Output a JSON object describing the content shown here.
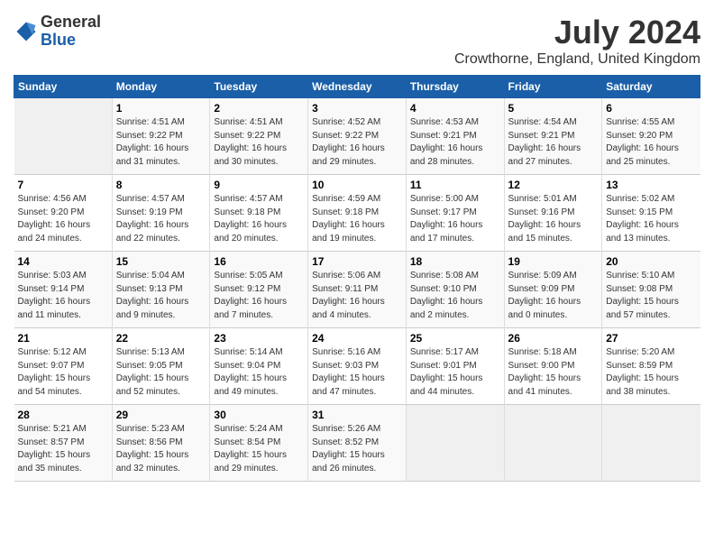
{
  "logo": {
    "general": "General",
    "blue": "Blue"
  },
  "header": {
    "month_year": "July 2024",
    "location": "Crowthorne, England, United Kingdom"
  },
  "weekdays": [
    "Sunday",
    "Monday",
    "Tuesday",
    "Wednesday",
    "Thursday",
    "Friday",
    "Saturday"
  ],
  "weeks": [
    [
      {
        "day": "",
        "detail": ""
      },
      {
        "day": "1",
        "detail": "Sunrise: 4:51 AM\nSunset: 9:22 PM\nDaylight: 16 hours\nand 31 minutes."
      },
      {
        "day": "2",
        "detail": "Sunrise: 4:51 AM\nSunset: 9:22 PM\nDaylight: 16 hours\nand 30 minutes."
      },
      {
        "day": "3",
        "detail": "Sunrise: 4:52 AM\nSunset: 9:22 PM\nDaylight: 16 hours\nand 29 minutes."
      },
      {
        "day": "4",
        "detail": "Sunrise: 4:53 AM\nSunset: 9:21 PM\nDaylight: 16 hours\nand 28 minutes."
      },
      {
        "day": "5",
        "detail": "Sunrise: 4:54 AM\nSunset: 9:21 PM\nDaylight: 16 hours\nand 27 minutes."
      },
      {
        "day": "6",
        "detail": "Sunrise: 4:55 AM\nSunset: 9:20 PM\nDaylight: 16 hours\nand 25 minutes."
      }
    ],
    [
      {
        "day": "7",
        "detail": "Sunrise: 4:56 AM\nSunset: 9:20 PM\nDaylight: 16 hours\nand 24 minutes."
      },
      {
        "day": "8",
        "detail": "Sunrise: 4:57 AM\nSunset: 9:19 PM\nDaylight: 16 hours\nand 22 minutes."
      },
      {
        "day": "9",
        "detail": "Sunrise: 4:57 AM\nSunset: 9:18 PM\nDaylight: 16 hours\nand 20 minutes."
      },
      {
        "day": "10",
        "detail": "Sunrise: 4:59 AM\nSunset: 9:18 PM\nDaylight: 16 hours\nand 19 minutes."
      },
      {
        "day": "11",
        "detail": "Sunrise: 5:00 AM\nSunset: 9:17 PM\nDaylight: 16 hours\nand 17 minutes."
      },
      {
        "day": "12",
        "detail": "Sunrise: 5:01 AM\nSunset: 9:16 PM\nDaylight: 16 hours\nand 15 minutes."
      },
      {
        "day": "13",
        "detail": "Sunrise: 5:02 AM\nSunset: 9:15 PM\nDaylight: 16 hours\nand 13 minutes."
      }
    ],
    [
      {
        "day": "14",
        "detail": "Sunrise: 5:03 AM\nSunset: 9:14 PM\nDaylight: 16 hours\nand 11 minutes."
      },
      {
        "day": "15",
        "detail": "Sunrise: 5:04 AM\nSunset: 9:13 PM\nDaylight: 16 hours\nand 9 minutes."
      },
      {
        "day": "16",
        "detail": "Sunrise: 5:05 AM\nSunset: 9:12 PM\nDaylight: 16 hours\nand 7 minutes."
      },
      {
        "day": "17",
        "detail": "Sunrise: 5:06 AM\nSunset: 9:11 PM\nDaylight: 16 hours\nand 4 minutes."
      },
      {
        "day": "18",
        "detail": "Sunrise: 5:08 AM\nSunset: 9:10 PM\nDaylight: 16 hours\nand 2 minutes."
      },
      {
        "day": "19",
        "detail": "Sunrise: 5:09 AM\nSunset: 9:09 PM\nDaylight: 16 hours\nand 0 minutes."
      },
      {
        "day": "20",
        "detail": "Sunrise: 5:10 AM\nSunset: 9:08 PM\nDaylight: 15 hours\nand 57 minutes."
      }
    ],
    [
      {
        "day": "21",
        "detail": "Sunrise: 5:12 AM\nSunset: 9:07 PM\nDaylight: 15 hours\nand 54 minutes."
      },
      {
        "day": "22",
        "detail": "Sunrise: 5:13 AM\nSunset: 9:05 PM\nDaylight: 15 hours\nand 52 minutes."
      },
      {
        "day": "23",
        "detail": "Sunrise: 5:14 AM\nSunset: 9:04 PM\nDaylight: 15 hours\nand 49 minutes."
      },
      {
        "day": "24",
        "detail": "Sunrise: 5:16 AM\nSunset: 9:03 PM\nDaylight: 15 hours\nand 47 minutes."
      },
      {
        "day": "25",
        "detail": "Sunrise: 5:17 AM\nSunset: 9:01 PM\nDaylight: 15 hours\nand 44 minutes."
      },
      {
        "day": "26",
        "detail": "Sunrise: 5:18 AM\nSunset: 9:00 PM\nDaylight: 15 hours\nand 41 minutes."
      },
      {
        "day": "27",
        "detail": "Sunrise: 5:20 AM\nSunset: 8:59 PM\nDaylight: 15 hours\nand 38 minutes."
      }
    ],
    [
      {
        "day": "28",
        "detail": "Sunrise: 5:21 AM\nSunset: 8:57 PM\nDaylight: 15 hours\nand 35 minutes."
      },
      {
        "day": "29",
        "detail": "Sunrise: 5:23 AM\nSunset: 8:56 PM\nDaylight: 15 hours\nand 32 minutes."
      },
      {
        "day": "30",
        "detail": "Sunrise: 5:24 AM\nSunset: 8:54 PM\nDaylight: 15 hours\nand 29 minutes."
      },
      {
        "day": "31",
        "detail": "Sunrise: 5:26 AM\nSunset: 8:52 PM\nDaylight: 15 hours\nand 26 minutes."
      },
      {
        "day": "",
        "detail": ""
      },
      {
        "day": "",
        "detail": ""
      },
      {
        "day": "",
        "detail": ""
      }
    ]
  ]
}
